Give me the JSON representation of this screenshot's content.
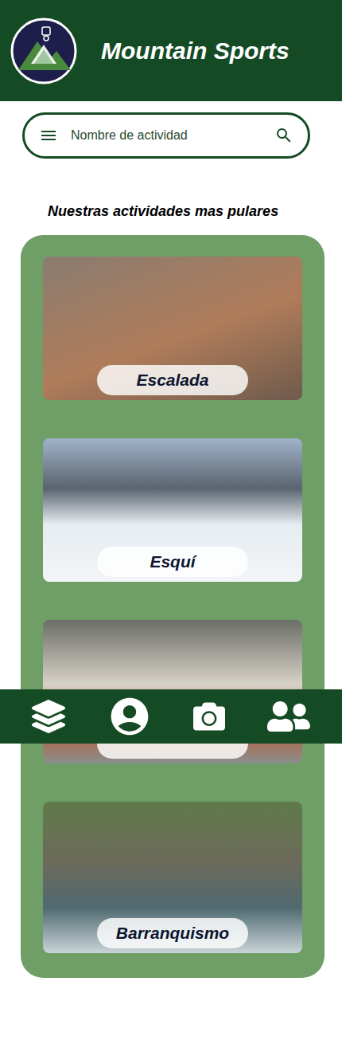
{
  "header": {
    "title": "Mountain Sports"
  },
  "search": {
    "placeholder": "Nombre de actividad"
  },
  "section": {
    "title": "Nuestras actividades mas pulares"
  },
  "activities": [
    {
      "label": "Escalada"
    },
    {
      "label": "Esquí"
    },
    {
      "label": ""
    },
    {
      "label": "Barranquismo"
    }
  ]
}
